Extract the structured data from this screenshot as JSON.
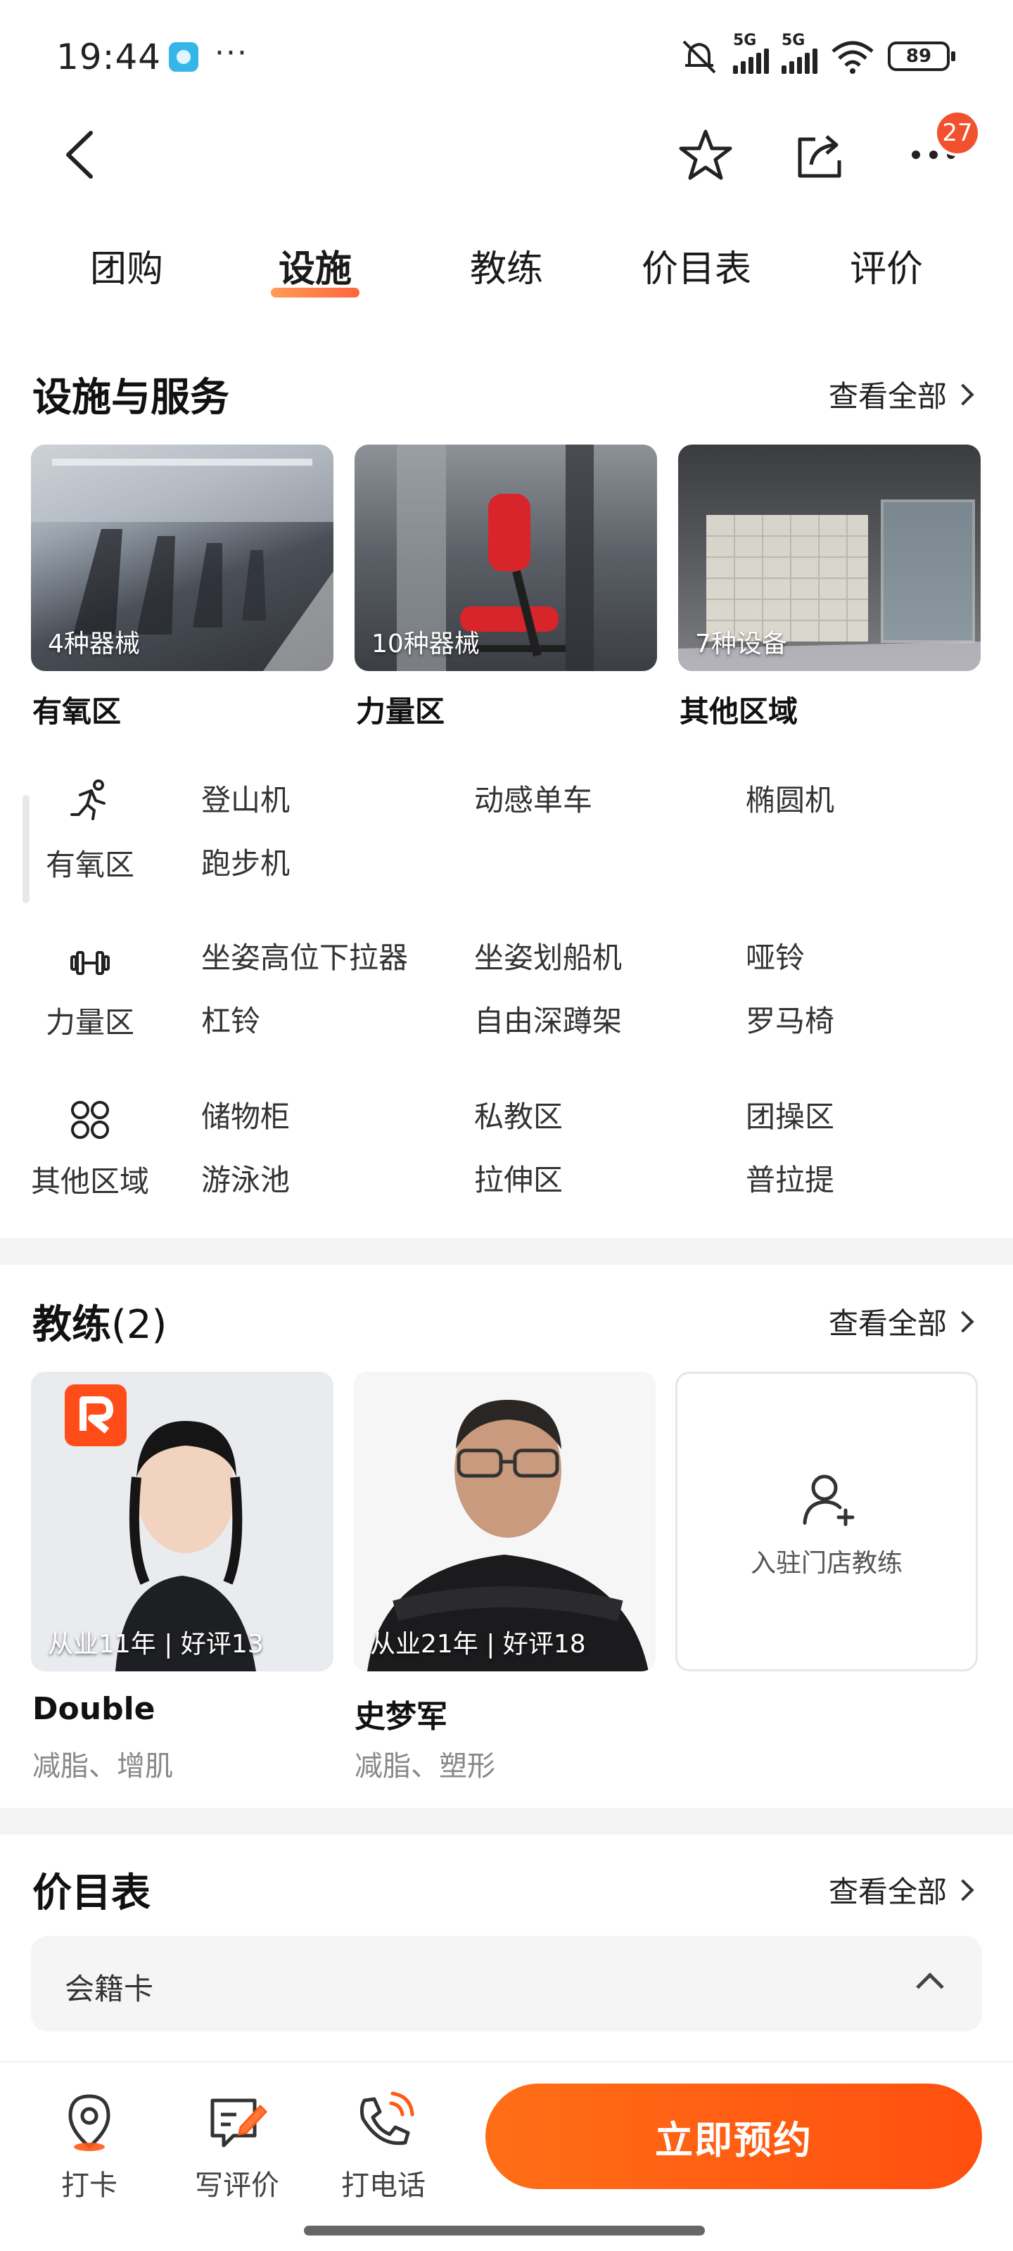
{
  "status_bar": {
    "time": "19:44",
    "dots": "···",
    "signal1_label": "5G",
    "signal2_label": "5G",
    "battery": "89"
  },
  "nav": {
    "badge_count": "27"
  },
  "tabs": [
    {
      "label": "团购"
    },
    {
      "label": "设施"
    },
    {
      "label": "教练"
    },
    {
      "label": "价目表"
    },
    {
      "label": "评价"
    }
  ],
  "facilities": {
    "title": "设施与服务",
    "see_all": "查看全部",
    "cards": [
      {
        "count": "4种器械",
        "title": "有氧区"
      },
      {
        "count": "10种器械",
        "title": "力量区"
      },
      {
        "count": "7种设备",
        "title": "其他区域"
      }
    ],
    "rows": [
      {
        "label": "有氧区",
        "icon": "running-icon",
        "items": [
          "登山机",
          "动感单车",
          "椭圆机",
          "跑步机"
        ]
      },
      {
        "label": "力量区",
        "icon": "dumbbell-icon",
        "items": [
          "坐姿高位下拉器",
          "坐姿划船机",
          "哑铃",
          "杠铃",
          "自由深蹲架",
          "罗马椅"
        ]
      },
      {
        "label": "其他区域",
        "icon": "grid-icon",
        "items": [
          "储物柜",
          "私教区",
          "团操区",
          "游泳池",
          "拉伸区",
          "普拉提"
        ]
      }
    ]
  },
  "coaches": {
    "title": "教练",
    "count": "(2)",
    "see_all": "查看全部",
    "items": [
      {
        "stat": "从业11年 | 好评13",
        "name": "Double",
        "tags": "减脂、增肌"
      },
      {
        "stat": "从业21年 | 好评18",
        "name": "史梦军",
        "tags": "减脂、塑形"
      }
    ],
    "join_label": "入驻门店教练"
  },
  "price_list": {
    "title": "价目表",
    "see_all": "查看全部",
    "category": "会籍卡"
  },
  "bottom": {
    "checkin": "打卡",
    "review": "写评价",
    "call": "打电话",
    "book": "立即预约"
  },
  "colors": {
    "accent": "#ff5a14",
    "badge": "#f1512f"
  }
}
